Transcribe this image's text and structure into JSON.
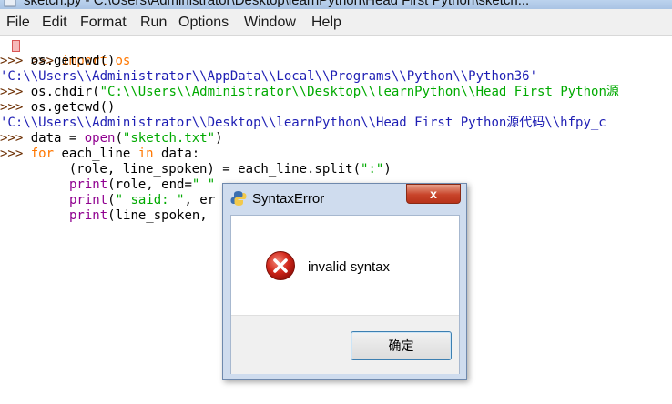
{
  "window": {
    "title": "sketch.py - C:\\Users\\Administrator\\Desktop\\learnPython\\Head First Python\\sketch..."
  },
  "menubar": {
    "items": [
      "File",
      "Edit",
      "Format",
      "Run",
      "Options",
      "Window",
      "Help"
    ]
  },
  "editor": {
    "prompt": ">>>",
    "line1_cmd": "import os",
    "line2_cmd": "os.getcwd()",
    "line3_out": "'C:\\\\Users\\\\Administrator\\\\AppData\\\\Local\\\\Programs\\\\Python\\\\Python36'",
    "line4_fn": "os.chdir(",
    "line4_arg": "\"C:\\\\Users\\\\Administrator\\\\Desktop\\\\learnPython\\\\Head First Python源",
    "line5_cmd": "os.getcwd()",
    "line6_out": "'C:\\\\Users\\\\Administrator\\\\Desktop\\\\learnPython\\\\Head First Python源代码\\\\hfpy_c",
    "line7_pre": "data = ",
    "line7_fn": "open",
    "line7_paren": "(",
    "line7_str": "\"sketch.txt\"",
    "line7_end": ")",
    "line8_for": "for",
    "line8_mid": " each_line ",
    "line8_in": "in",
    "line8_end": " data:",
    "line9_a": "    (role, line_spoken) = each_line.split(",
    "line9_str": "\":\"",
    "line9_end": ")",
    "line10_fn": "print",
    "line10_mid": "(role, end=",
    "line10_str": "\" \"",
    "line11_fn": "print",
    "line11_open": "(",
    "line11_str": "\" said: \"",
    "line11_end": ", er",
    "line12_fn": "print",
    "line12_end": "(line_spoken,"
  },
  "dialog": {
    "title": "SyntaxError",
    "close_label": "x",
    "message": "invalid syntax",
    "ok_label": "确定"
  },
  "icons": {
    "app": "python-icon",
    "error": "error-icon",
    "close": "close-icon"
  },
  "colors": {
    "keyword": "#ff7700",
    "string": "#00aa00",
    "output": "#1e1eb4",
    "builtin": "#900090",
    "prompt": "#6b2d00"
  }
}
